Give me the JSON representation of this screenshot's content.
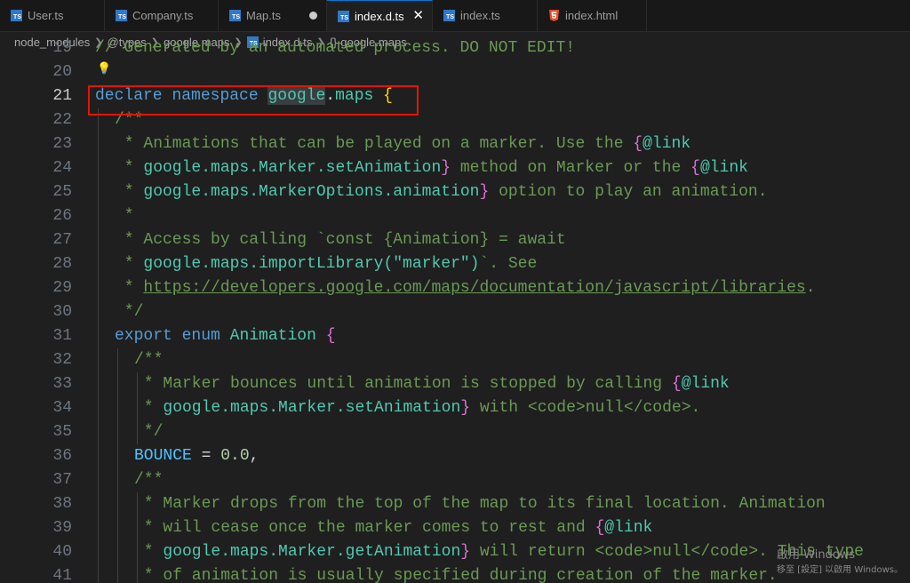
{
  "tabs": [
    {
      "label": "User.ts",
      "icon": "ts-file-icon",
      "state": "normal"
    },
    {
      "label": "Company.ts",
      "icon": "ts-file-icon",
      "state": "normal"
    },
    {
      "label": "Map.ts",
      "icon": "ts-file-icon",
      "state": "modified"
    },
    {
      "label": "index.d.ts",
      "icon": "ts-file-icon",
      "state": "active"
    },
    {
      "label": "index.ts",
      "icon": "ts-file-icon",
      "state": "normal"
    },
    {
      "label": "index.html",
      "icon": "html-file-icon",
      "state": "normal"
    }
  ],
  "tab_icon_text": "TS",
  "close_glyph": "✕",
  "breadcrumb": {
    "parts": [
      "node_modules",
      "@types",
      "google.maps",
      "index.d.ts",
      "google.maps"
    ],
    "symbol_glyph": "{}"
  },
  "current_line": 21,
  "code_lines": [
    {
      "n": 19,
      "top_text": "// Generated by an automated process. DO NOT EDIT!"
    },
    {
      "n": 20
    },
    {
      "n": 21,
      "kw1": "declare",
      "kw2": "namespace",
      "ns1": "google",
      "dot": ".",
      "ns2": "maps",
      "brace": "{"
    },
    {
      "n": 22,
      "text": "/**"
    },
    {
      "n": 23,
      "a": " * Animations that can be played on a marker. Use the ",
      "b": "{",
      "c": "@link"
    },
    {
      "n": 24,
      "a": " * ",
      "b": "google.maps.Marker.setAnimation",
      "c": "}",
      "d": " method on Marker or the ",
      "e": "{",
      "f": "@link"
    },
    {
      "n": 25,
      "a": " * ",
      "b": "google.maps.MarkerOptions.animation",
      "c": "}",
      "d": " option to play an animation."
    },
    {
      "n": 26,
      "text": " *"
    },
    {
      "n": 27,
      "text": " * Access by calling `const {Animation} = await"
    },
    {
      "n": 28,
      "a": " * ",
      "b": "google.maps.importLibrary(\"marker\")",
      "c": "`. See"
    },
    {
      "n": 29,
      "a": " * ",
      "b": "https://developers.google.com/maps/documentation/javascript/libraries",
      "c": "."
    },
    {
      "n": 30,
      "text": " */"
    },
    {
      "n": 31,
      "kw1": "export",
      "kw2": "enum",
      "ns1": "Animation",
      "brace": "{"
    },
    {
      "n": 32,
      "text": "/**"
    },
    {
      "n": 33,
      "a": " * Marker bounces until animation is stopped by calling ",
      "b": "{",
      "c": "@link"
    },
    {
      "n": 34,
      "a": " * ",
      "b": "google.maps.Marker.setAnimation",
      "c": "}",
      "d": " with <code>null</code>."
    },
    {
      "n": 35,
      "text": " */"
    },
    {
      "n": 36,
      "member": "BOUNCE",
      "eq": " = ",
      "num": "0.0",
      "end": ","
    },
    {
      "n": 37,
      "text": "/**"
    },
    {
      "n": 38,
      "text": " * Marker drops from the top of the map to its final location. Animation"
    },
    {
      "n": 39,
      "a": " * will cease once the marker comes to rest and ",
      "b": "{",
      "c": "@link"
    },
    {
      "n": 40,
      "a": " * ",
      "b": "google.maps.Marker.getAnimation",
      "c": "}",
      "d": " will return <code>null</code>. This type"
    },
    {
      "n": 41,
      "text": " * of animation is usually specified during creation of the marker."
    }
  ],
  "watermark": {
    "line1": "啟用 Windows",
    "line2": "移至 [設定] 以啟用 Windows。"
  },
  "colors": {
    "keyword": "#569cd6",
    "type": "#4ec9b0",
    "comment": "#6a9955",
    "brace": "#ffd700",
    "highlight_box": "#e51400"
  }
}
